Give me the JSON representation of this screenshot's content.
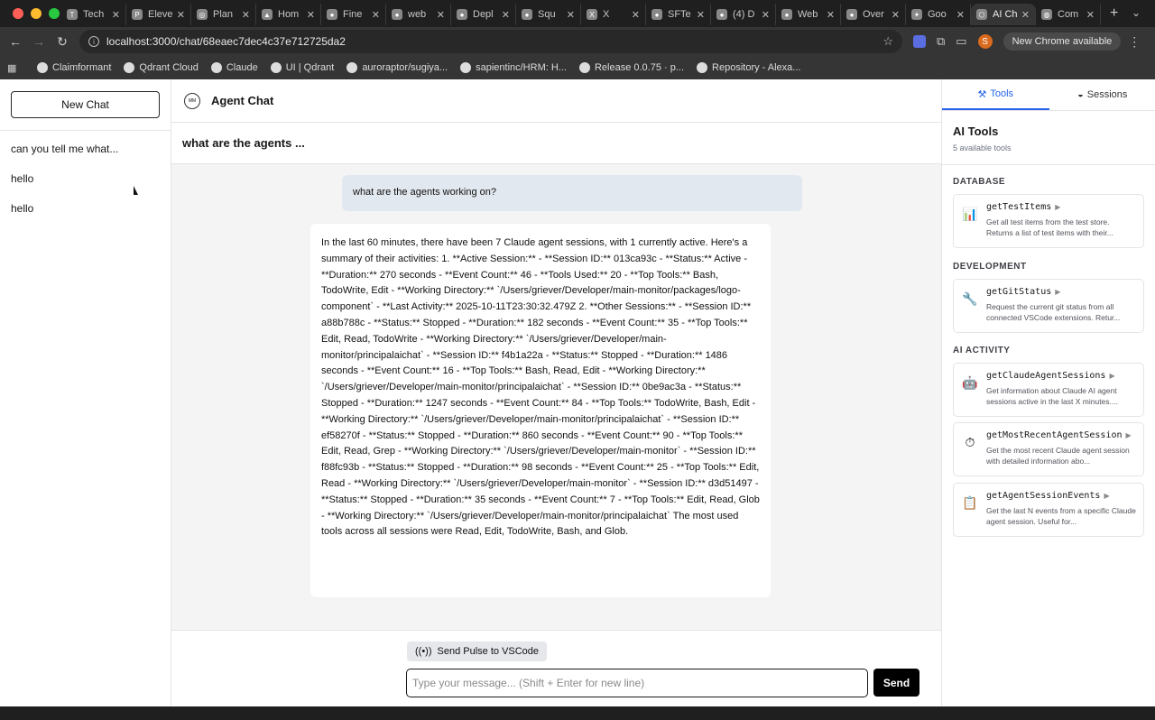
{
  "browser": {
    "tabs": [
      {
        "label": "Tech",
        "icon": "T"
      },
      {
        "label": "Eleve",
        "icon": "P"
      },
      {
        "label": "Plan",
        "icon": "◎"
      },
      {
        "label": "Hom",
        "icon": "▲"
      },
      {
        "label": "Fine",
        "icon": "●"
      },
      {
        "label": "web",
        "icon": "●"
      },
      {
        "label": "Depl",
        "icon": "●"
      },
      {
        "label": "Squ",
        "icon": "●"
      },
      {
        "label": "X",
        "icon": "X"
      },
      {
        "label": "SFTe",
        "icon": "●"
      },
      {
        "label": "(4) D",
        "icon": "●"
      },
      {
        "label": "Web",
        "icon": "●"
      },
      {
        "label": "Over",
        "icon": "●"
      },
      {
        "label": "Goo",
        "icon": "✦"
      },
      {
        "label": "AI Ch",
        "icon": "⬡"
      },
      {
        "label": "Com",
        "icon": "◍"
      }
    ],
    "url": "localhost:3000/chat/68eaec7dec4c37e712725da2",
    "profile_initial": "S",
    "update_label": "New Chrome available",
    "bookmarks": [
      "Claimformant",
      "Qdrant Cloud",
      "Claude",
      "UI | Qdrant",
      "auroraptor/sugiya...",
      "sapientinc/HRM: H...",
      "Release 0.0.75 · p...",
      "Repository - Alexa..."
    ]
  },
  "sidebar": {
    "new_chat_label": "New Chat",
    "conversations": [
      "can you tell me what...",
      "hello",
      "hello"
    ]
  },
  "header": {
    "logo_text": "MM",
    "title": "Agent Chat"
  },
  "conversation": {
    "title": "what are the agents ...",
    "user_message": "what are the agents working on?",
    "assistant_message": "In the last 60 minutes, there have been 7 Claude agent sessions, with 1 currently active. Here's a summary of their activities: 1. **Active Session:** - **Session ID:** 013ca93c - **Status:** Active - **Duration:** 270 seconds - **Event Count:** 46 - **Tools Used:** 20 - **Top Tools:** Bash, TodoWrite, Edit - **Working Directory:** `/Users/griever/Developer/main-monitor/packages/logo-component` - **Last Activity:** 2025-10-11T23:30:32.479Z 2. **Other Sessions:** - **Session ID:** a88b788c - **Status:** Stopped - **Duration:** 182 seconds - **Event Count:** 35 - **Top Tools:** Edit, Read, TodoWrite - **Working Directory:** `/Users/griever/Developer/main-monitor/principalaichat` - **Session ID:** f4b1a22a - **Status:** Stopped - **Duration:** 1486 seconds - **Event Count:** 16 - **Top Tools:** Bash, Read, Edit - **Working Directory:** `/Users/griever/Developer/main-monitor/principalaichat` - **Session ID:** 0be9ac3a - **Status:** Stopped - **Duration:** 1247 seconds - **Event Count:** 84 - **Top Tools:** TodoWrite, Bash, Edit - **Working Directory:** `/Users/griever/Developer/main-monitor/principalaichat` - **Session ID:** ef58270f - **Status:** Stopped - **Duration:** 860 seconds - **Event Count:** 90 - **Top Tools:** Edit, Read, Grep - **Working Directory:** `/Users/griever/Developer/main-monitor` - **Session ID:** f88fc93b - **Status:** Stopped - **Duration:** 98 seconds - **Event Count:** 25 - **Top Tools:** Edit, Read - **Working Directory:** `/Users/griever/Developer/main-monitor` - **Session ID:** d3d51497 - **Status:** Stopped - **Duration:** 35 seconds - **Event Count:** 7 - **Top Tools:** Edit, Read, Glob - **Working Directory:** `/Users/griever/Developer/main-monitor/principalaichat` The most used tools across all sessions were Read, Edit, TodoWrite, Bash, and Glob."
  },
  "composer": {
    "pulse_label": "Send Pulse to VSCode",
    "placeholder": "Type your message... (Shift + Enter for new line)",
    "send_label": "Send"
  },
  "tools_panel": {
    "tab_tools": "Tools",
    "tab_sessions": "Sessions",
    "title": "AI Tools",
    "subtitle": "5 available tools",
    "sections": [
      {
        "label": "DATABASE",
        "tools": [
          {
            "name": "getTestItems",
            "icon": "bar-chart-icon",
            "glyph": "📊",
            "desc": "Get all test items from the test store. Returns a list of test items with their..."
          }
        ]
      },
      {
        "label": "DEVELOPMENT",
        "tools": [
          {
            "name": "getGitStatus",
            "icon": "wrench-icon",
            "glyph": "🔧",
            "desc": "Request the current git status from all connected VSCode extensions. Retur..."
          }
        ]
      },
      {
        "label": "AI ACTIVITY",
        "tools": [
          {
            "name": "getClaudeAgentSessions",
            "icon": "robot-icon",
            "glyph": "🤖",
            "desc": "Get information about Claude AI agent sessions active in the last X minutes...."
          },
          {
            "name": "getMostRecentAgentSession",
            "icon": "stopwatch-icon",
            "glyph": "⏱",
            "desc": "Get the most recent Claude agent session with detailed information abo..."
          },
          {
            "name": "getAgentSessionEvents",
            "icon": "clipboard-icon",
            "glyph": "📋",
            "desc": "Get the last N events from a specific Claude agent session. Useful for..."
          }
        ]
      }
    ]
  },
  "colors": {
    "accent": "#2563eb",
    "user_bubble": "#e2e8f0",
    "send_button": "#000000"
  }
}
